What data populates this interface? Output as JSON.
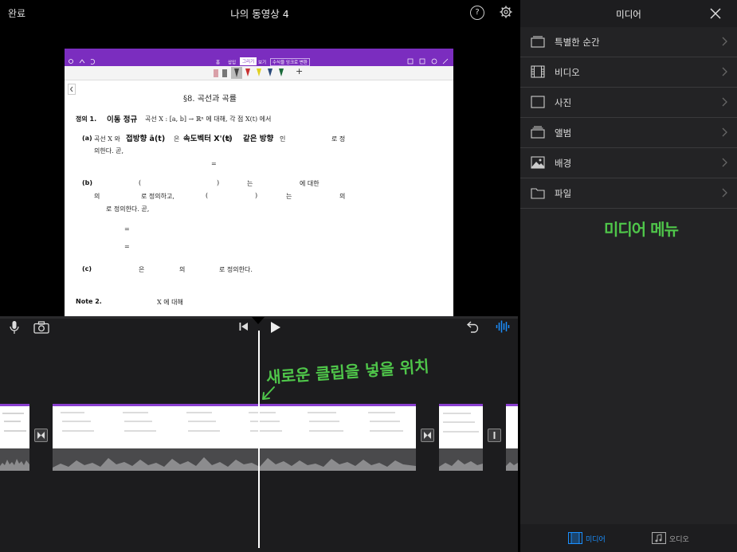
{
  "header": {
    "done_label": "완료",
    "project_title": "나의 동영상 4",
    "help_label": "?"
  },
  "document": {
    "section_title": "§8. 곡선과 곡률",
    "definition": {
      "label": "정의 1.",
      "handwritten_title": "이동 정규",
      "text": "곡선 X : [a, b] → ℝⁿ 에 대해, 각 점 X(t) 에서",
      "item_a_label": "(a)",
      "item_a_text1": "곡선 X 와",
      "item_a_hand1": "접방향 ā(t)",
      "item_a_text2": "은",
      "item_a_hand2": "속도벡터 X'(t)",
      "item_a_text3": "와",
      "item_a_hand3": "같은 방향",
      "item_a_text4": "인",
      "item_a_text5": "로 정",
      "item_a_line2": "의한다. 곧,",
      "eq1": "=",
      "item_b_label": "(b)",
      "item_b_l1a": "(",
      "item_b_l1b": ")",
      "item_b_l1c": "는",
      "item_b_l1d": "에 대한",
      "item_b_l2a": "의",
      "item_b_l2b": "로 정의하고,",
      "item_b_l2c": "(",
      "item_b_l2d": ")",
      "item_b_l2e": "는",
      "item_b_l2f": "의",
      "item_b_l3": "로 정의한다. 곧,",
      "eq2": "=",
      "eq3": "=",
      "item_c_label": "(c)",
      "item_c_a": "은",
      "item_c_b": "의",
      "item_c_c": "로 정의한다.",
      "note_label": "Note 2.",
      "note_text": "X 에 대해",
      "eq4": "="
    },
    "toolbar_tabs": [
      "홈",
      "삽입",
      "그리기",
      "보기",
      "수식을 잉크로 변환"
    ]
  },
  "timeline": {
    "annotation": "새로운 클립을 넣을 위치"
  },
  "media_panel": {
    "title": "미디어",
    "items": [
      {
        "label": "특별한 순간",
        "icon": "moments-icon"
      },
      {
        "label": "비디오",
        "icon": "film-icon"
      },
      {
        "label": "사진",
        "icon": "photo-icon"
      },
      {
        "label": "앨범",
        "icon": "album-icon"
      },
      {
        "label": "배경",
        "icon": "landscape-icon"
      },
      {
        "label": "파일",
        "icon": "folder-icon"
      }
    ],
    "annotation": "미디어 메뉴",
    "bottom_tabs": {
      "media_label": "미디어",
      "audio_label": "오디오"
    }
  },
  "colors": {
    "accent_blue": "#1a8fff",
    "annotation_green": "#4fc64a",
    "doc_purple": "#7b2dbf"
  }
}
